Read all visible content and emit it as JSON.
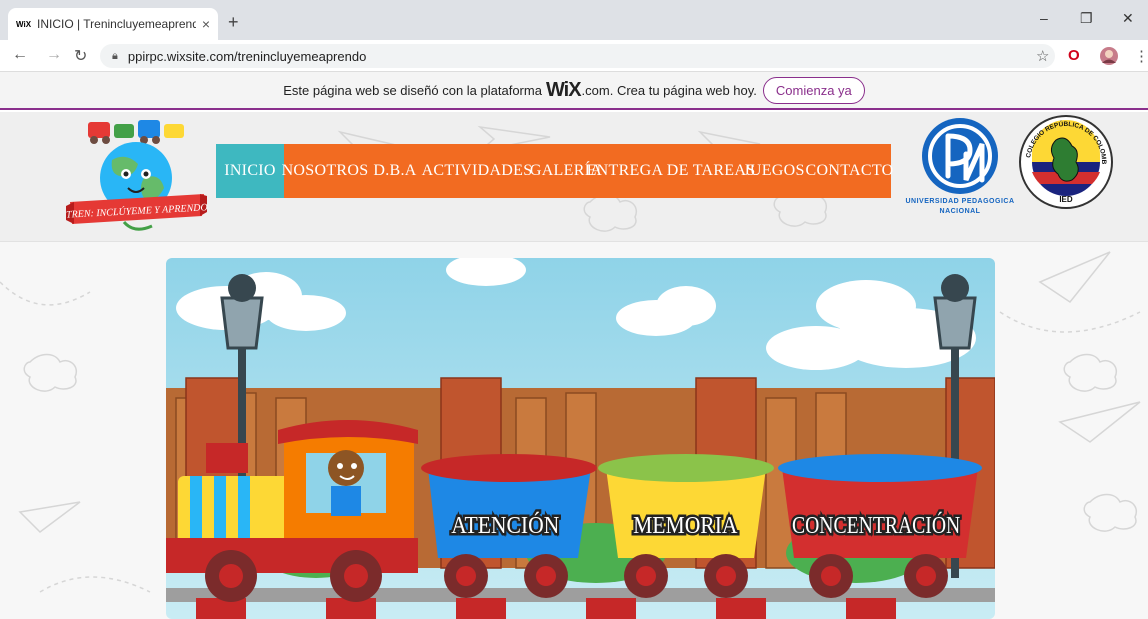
{
  "browser": {
    "tab_favicon": "WiX",
    "tab_title": "INICIO | Trenincluyemeaprendo",
    "tab_close": "×",
    "new_tab": "+",
    "url": "ppirpc.wixsite.com/trenincluyemeaprendo",
    "win_minimize": "–",
    "win_restore": "❐",
    "win_close": "✕"
  },
  "wix_banner": {
    "text_before": "Este página web se diseñó con la plataforma",
    "logo": "WiX",
    "text_after": ".com. Crea tu página web hoy.",
    "cta": "Comienza ya"
  },
  "site": {
    "logo_text": "TREN: INCLÚYEME Y APRENDO",
    "menu": [
      {
        "label": "INICIO",
        "active": true
      },
      {
        "label": "NOSOTROS"
      },
      {
        "label": "D.B.A"
      },
      {
        "label": "ACTIVIDADES"
      },
      {
        "label": "GALERÍA"
      },
      {
        "label": "ENTREGA DE TAREAS"
      },
      {
        "label": "JUEGOS"
      },
      {
        "label": "CONTACTO"
      }
    ],
    "upn_line1": "UNIVERSIDAD PEDAGOGICA",
    "upn_line2": "NACIONAL",
    "ied_arc": "COLEGIO REPÚBLICA DE COLOMBIA",
    "ied_short": "IED"
  },
  "hero": {
    "wagons": [
      "ATENCIÓN",
      "MEMORIA",
      "CONCENTRACIÓN"
    ]
  },
  "colors": {
    "menu_bg": "#f26b21",
    "menu_active": "#3eb8c0",
    "wix_accent": "#8a2f8c"
  }
}
